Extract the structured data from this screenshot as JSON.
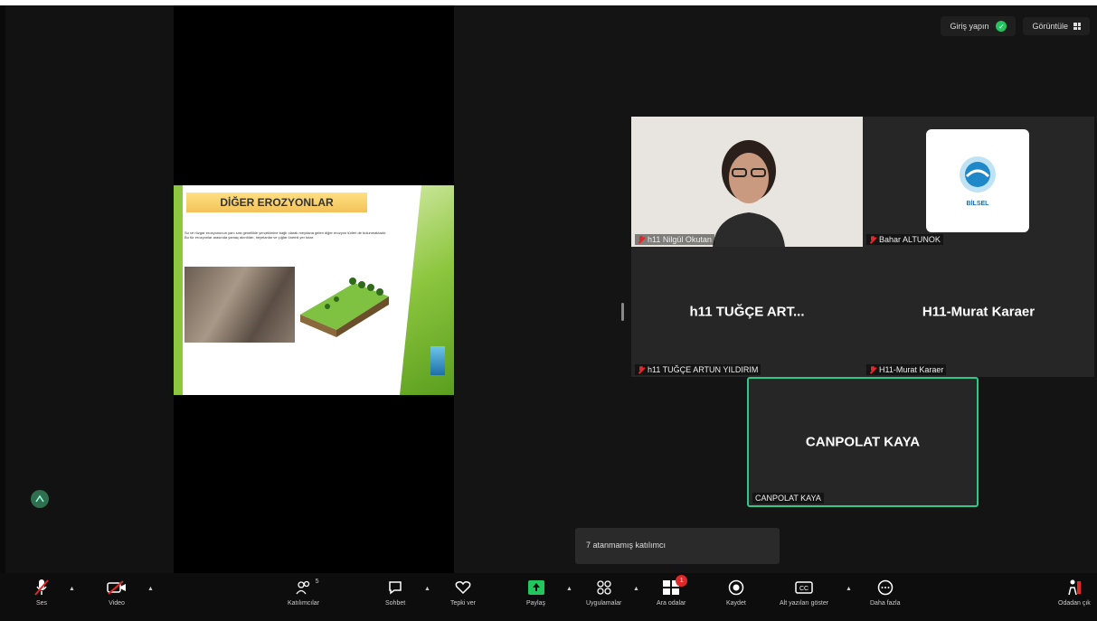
{
  "top_controls": {
    "login_label": "Giriş yapın",
    "view_label": "Görüntüle"
  },
  "slide": {
    "title": "DİĞER EROZYONLAR",
    "body": "Su ve rüzgar erozyonunun yanı sıra genellikle yerçekimine bağlı olarak meydana gelen diğer erozyon türleri de bulunmaktadır. Bu tür erozyonlar arasında yamaç akıntıları, heyelanlar ve çığlar önemli yer tutar."
  },
  "tiles": [
    {
      "display_name": "",
      "tag": "h11 Nilgül Okutan",
      "muted": true
    },
    {
      "display_name": "",
      "tag": "Bahar ALTUNOK",
      "muted": true,
      "logo_text": "BİLSEL"
    },
    {
      "display_name": "h11 TUĞÇE ART...",
      "tag": "h11 TUĞÇE ARTUN YILDIRIM",
      "muted": true
    },
    {
      "display_name": "H11-Murat Karaer",
      "tag": "H11-Murat Karaer",
      "muted": true
    },
    {
      "display_name": "CANPOLAT KAYA",
      "tag": "CANPOLAT KAYA",
      "muted": false,
      "active_speaker": true
    }
  ],
  "toast": {
    "text": "7 atanmamış katılımcı"
  },
  "toolbar": {
    "audio_label": "Ses",
    "video_label": "Video",
    "participants_label": "Katılımcılar",
    "participants_count": "5",
    "chat_label": "Sohbet",
    "react_label": "Tepki ver",
    "share_label": "Paylaş",
    "apps_label": "Uygulamalar",
    "breakout_label": "Ara odalar",
    "breakout_badge": "1",
    "record_label": "Kaydet",
    "captions_label": "Alt yazıları göster",
    "more_label": "Daha fazla",
    "leave_label": "Odadan çık"
  },
  "colors": {
    "active_speaker_border": "#2dc98a",
    "share_green": "#22c55e",
    "muted_red": "#e02828"
  }
}
